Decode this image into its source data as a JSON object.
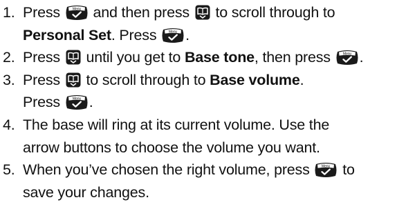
{
  "steps": [
    {
      "number": "1.",
      "lines": [
        [
          "Press ",
          {
            "icon": "menu-ok-key-icon",
            "label": "Menu"
          },
          " and then press ",
          {
            "icon": "phonebook-scroll-key-icon"
          },
          " to scroll through to"
        ],
        [
          {
            "bold": "Personal Set"
          },
          ". Press ",
          {
            "icon": "menu-ok-key-icon",
            "label": "Menu"
          },
          "."
        ]
      ]
    },
    {
      "number": "2.",
      "lines": [
        [
          "Press ",
          {
            "icon": "phonebook-scroll-key-icon"
          },
          " until you get to ",
          {
            "bold": "Base tone"
          },
          ", then press ",
          {
            "icon": "menu-ok-key-icon",
            "label": "Menu"
          },
          "."
        ]
      ]
    },
    {
      "number": "3.",
      "lines": [
        [
          "Press ",
          {
            "icon": "phonebook-scroll-key-icon"
          },
          " to scroll through to ",
          {
            "bold": "Base volume"
          },
          "."
        ],
        [
          "Press ",
          {
            "icon": "menu-ok-key-icon",
            "label": "Menu"
          },
          "."
        ]
      ]
    },
    {
      "number": "4.",
      "lines": [
        [
          "The base will ring at its current volume. Use the"
        ],
        [
          "arrow buttons to choose the volume you want."
        ]
      ]
    },
    {
      "number": "5.",
      "lines": [
        [
          "When you’ve chosen the right volume, press ",
          {
            "icon": "menu-ok-key-icon",
            "label": "Menu"
          },
          " to"
        ],
        [
          "save your changes."
        ]
      ]
    }
  ]
}
